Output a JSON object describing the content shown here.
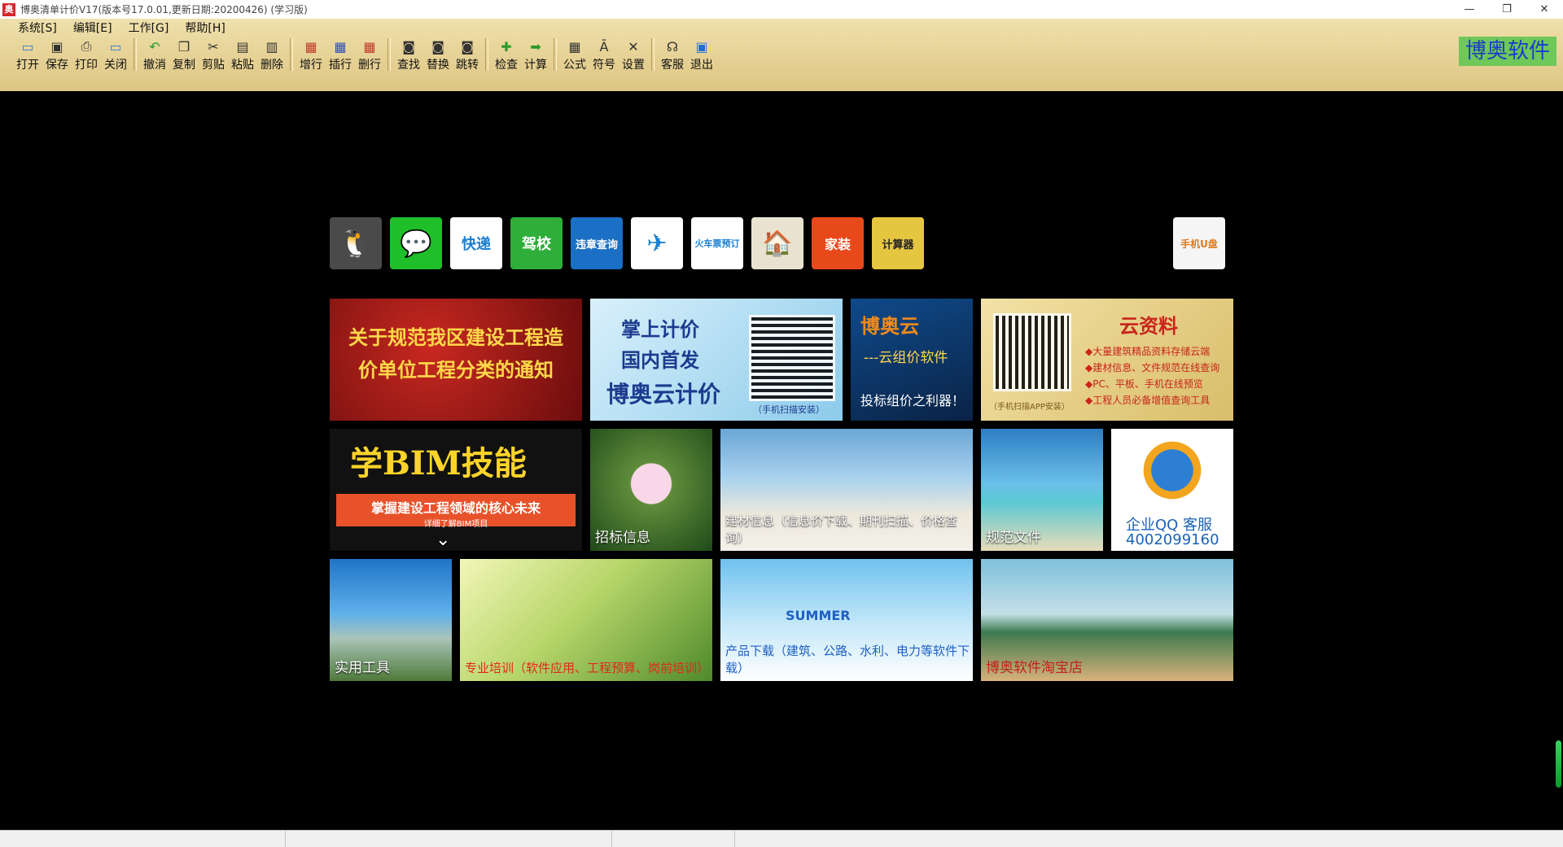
{
  "window": {
    "title": "博奥清单计价V17(版本号17.0.01,更新日期:20200426) (学习版)",
    "icon_text": "奥",
    "minimize": "—",
    "restore": "❐",
    "close": "✕"
  },
  "menu": [
    {
      "label": "系统[S]"
    },
    {
      "label": "编辑[E]"
    },
    {
      "label": "工作[G]"
    },
    {
      "label": "帮助[H]"
    }
  ],
  "toolbar": [
    {
      "label": "打开",
      "icon": "folder-icon"
    },
    {
      "label": "保存",
      "icon": "save-icon"
    },
    {
      "label": "打印",
      "icon": "print-icon"
    },
    {
      "label": "关闭",
      "icon": "close-doc-icon"
    },
    {
      "label": "撤消",
      "icon": "undo-icon"
    },
    {
      "label": "复制",
      "icon": "copy-icon"
    },
    {
      "label": "剪贴",
      "icon": "cut-icon"
    },
    {
      "label": "粘贴",
      "icon": "paste-icon"
    },
    {
      "label": "删除",
      "icon": "delete-icon"
    },
    {
      "label": "增行",
      "icon": "add-row-icon"
    },
    {
      "label": "插行",
      "icon": "insert-row-icon"
    },
    {
      "label": "删行",
      "icon": "delete-row-icon"
    },
    {
      "label": "查找",
      "icon": "binoculars-icon"
    },
    {
      "label": "替换",
      "icon": "replace-icon"
    },
    {
      "label": "跳转",
      "icon": "jump-icon"
    },
    {
      "label": "检查",
      "icon": "check-icon"
    },
    {
      "label": "计算",
      "icon": "calc-arrow-icon"
    },
    {
      "label": "公式",
      "icon": "formula-icon"
    },
    {
      "label": "符号",
      "icon": "symbol-icon"
    },
    {
      "label": "设置",
      "icon": "settings-icon"
    },
    {
      "label": "客服",
      "icon": "headset-icon"
    },
    {
      "label": "退出",
      "icon": "exit-icon"
    }
  ],
  "brand": "博奥软件",
  "quick_links": [
    {
      "name": "qq-icon",
      "text": "🐧"
    },
    {
      "name": "wechat-icon",
      "text": "💬"
    },
    {
      "name": "express-icon",
      "text": "快递"
    },
    {
      "name": "driving-school-icon",
      "text": "驾校"
    },
    {
      "name": "traffic-violation-icon",
      "text": "违章查询"
    },
    {
      "name": "airline-icon",
      "text": "✈"
    },
    {
      "name": "train-ticket-icon",
      "text": "火车票预订"
    },
    {
      "name": "building-icon",
      "text": "🏠"
    },
    {
      "name": "home-decor-icon",
      "text": "家装"
    },
    {
      "name": "calculator-icon",
      "text": "计算器"
    },
    {
      "name": "phone-udisk-icon",
      "text": "手机U盘"
    }
  ],
  "tiles": {
    "notice": "关于规范我区建设工程造价单位工程分类的通知",
    "cloud_price_line1": "掌上计价",
    "cloud_price_line2": "国内首发",
    "cloud_price_line3": "博奥云计价",
    "cloud_price_scan": "（手机扫描安装）",
    "cloud_software_title": "博奥云",
    "cloud_software_sub": "---云组价软件",
    "cloud_software_slogan": "投标组价之利器！",
    "cloud_data_title": "云资料",
    "cloud_data_items": [
      "◆大量建筑精品资料存储云端",
      "◆建材信息、文件规范在线查询",
      "◆PC、平板、手机在线预览",
      "◆工程人员必备增值查询工具"
    ],
    "cloud_data_scan": "（手机扫描APP安装）",
    "bim_title": "学BIM技能",
    "bim_sub": "掌握建设工程领域的核心未来",
    "bim_btn": "详细了解BIM项目",
    "bidding": "招标信息",
    "materials": "建材信息（信息价下载、期刊扫描、价格查询）",
    "standards": "规范文件",
    "qq_service": "企业QQ 客服",
    "qq_phone": "4002099160",
    "tools": "实用工具",
    "training": "专业培训（软件应用、工程预算、岗前培训）",
    "summer": "SUMMER",
    "downloads": "产品下载（建筑、公路、水利、电力等软件下载）",
    "taobao": "博奥软件淘宝店"
  }
}
